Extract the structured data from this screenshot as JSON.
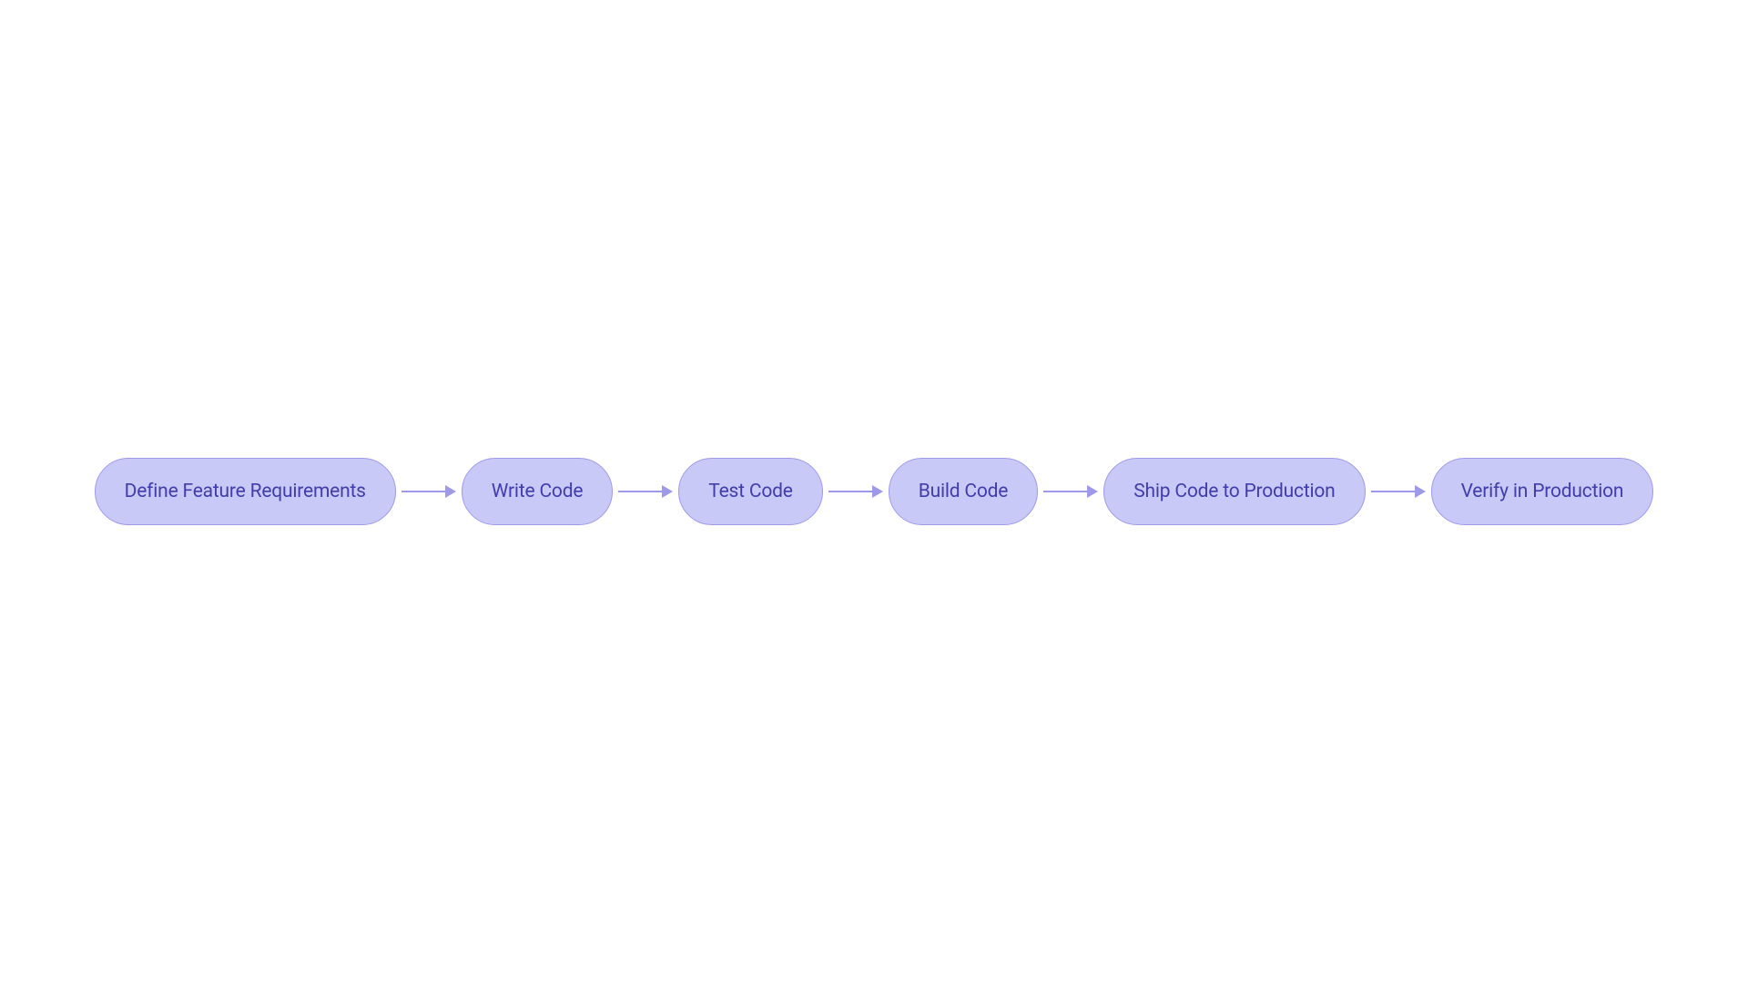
{
  "flow": {
    "nodes": [
      {
        "label": "Define Feature Requirements"
      },
      {
        "label": "Write Code"
      },
      {
        "label": "Test Code"
      },
      {
        "label": "Build Code"
      },
      {
        "label": "Ship Code to Production"
      },
      {
        "label": "Verify in Production"
      }
    ]
  },
  "colors": {
    "node_fill": "#c9c9f7",
    "node_border": "#9e9ae8",
    "node_text": "#3f3eaa",
    "arrow": "#9e9ae8",
    "background": "#ffffff"
  }
}
